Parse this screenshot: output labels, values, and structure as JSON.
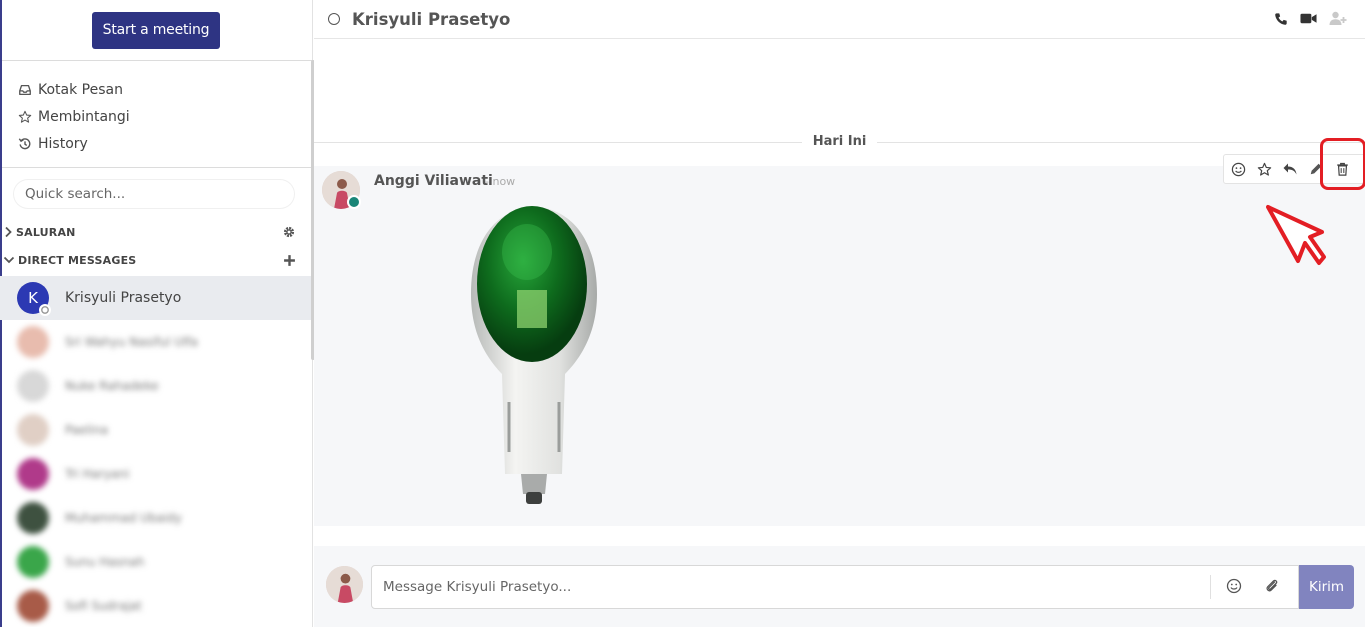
{
  "sidebar": {
    "meeting_button": "Start a meeting",
    "nav": [
      {
        "label": "Kotak Pesan",
        "icon": "inbox-icon"
      },
      {
        "label": "Membintangi",
        "icon": "star-icon"
      },
      {
        "label": "History",
        "icon": "history-icon"
      }
    ],
    "search_placeholder": "Quick search...",
    "sections": {
      "channels": "SALURAN",
      "direct_messages": "DIRECT MESSAGES"
    },
    "direct_messages": [
      {
        "name": "Krisyuli Prasetyo",
        "initial": "K",
        "active": true
      },
      {
        "name": "Sri Wahyu Nasiful Ulfa",
        "avatar_color": "#e8bcae"
      },
      {
        "name": "Nuke Rahadeke",
        "avatar_color": "#d8d8d8"
      },
      {
        "name": "Paelina",
        "avatar_color": "#e0cfc5"
      },
      {
        "name": "Tri Haryani",
        "avatar_color": "#b03a8a"
      },
      {
        "name": "Muhammad Ubaidy",
        "avatar_color": "#3e5140"
      },
      {
        "name": "Sunu Hasnah",
        "avatar_color": "#3aa64a"
      },
      {
        "name": "Sofi Sudrajat",
        "avatar_color": "#a85b48"
      }
    ]
  },
  "chat": {
    "title": "Krisyuli Prasetyo",
    "date_divider": "Hari Ini",
    "message": {
      "author": "Anggi Viliawati",
      "time": "- now"
    },
    "composer": {
      "placeholder": "Message Krisyuli Prasetyo...",
      "send_label": "Kirim"
    }
  },
  "colors": {
    "accent": "#2e3483",
    "send": "#8184bf",
    "highlight": "#e31e24",
    "online": "#1a8577"
  }
}
